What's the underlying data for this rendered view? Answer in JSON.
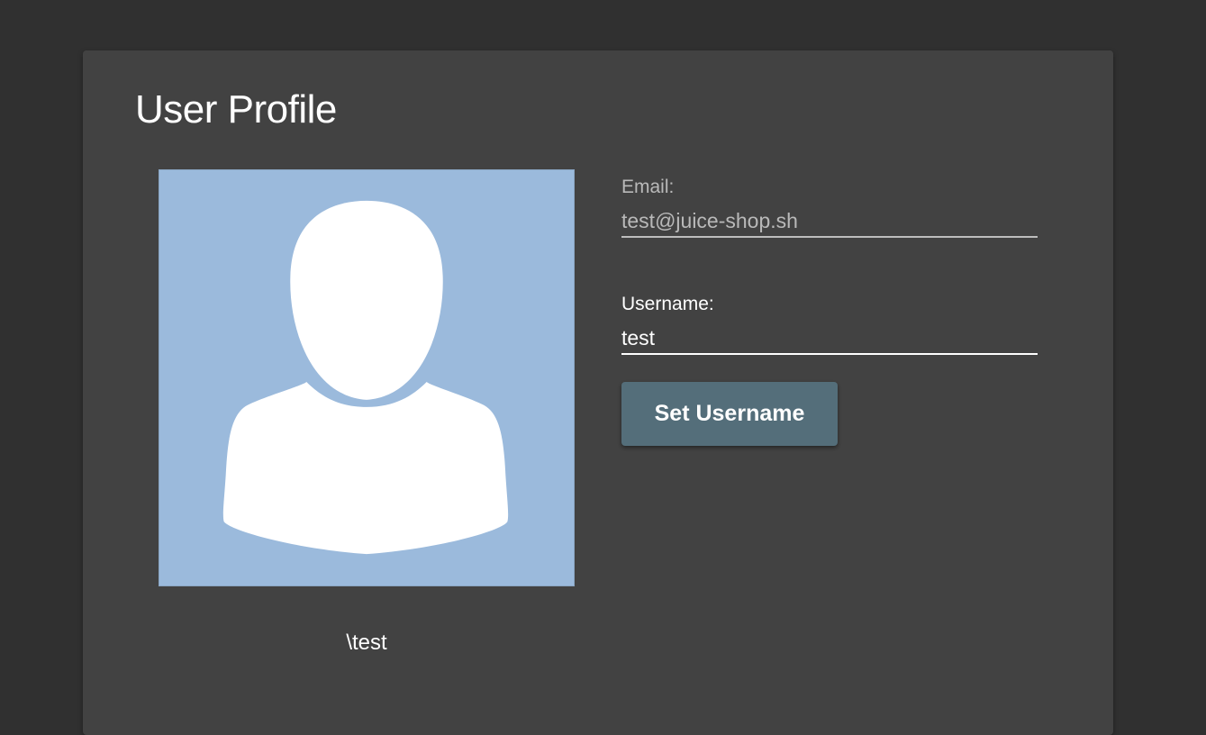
{
  "page": {
    "title": "User Profile"
  },
  "avatar": {
    "icon": "default-user-silhouette-icon",
    "background_color": "#9bbadc",
    "figure_color": "#ffffff"
  },
  "profile": {
    "display_name": "\\test"
  },
  "email_field": {
    "label": "Email:",
    "value": "test@juice-shop.sh"
  },
  "username_field": {
    "label": "Username:",
    "value": "test"
  },
  "actions": {
    "set_username_label": "Set Username"
  },
  "colors": {
    "page_background": "#303030",
    "card_background": "#424242",
    "button_background": "#546e7a"
  }
}
